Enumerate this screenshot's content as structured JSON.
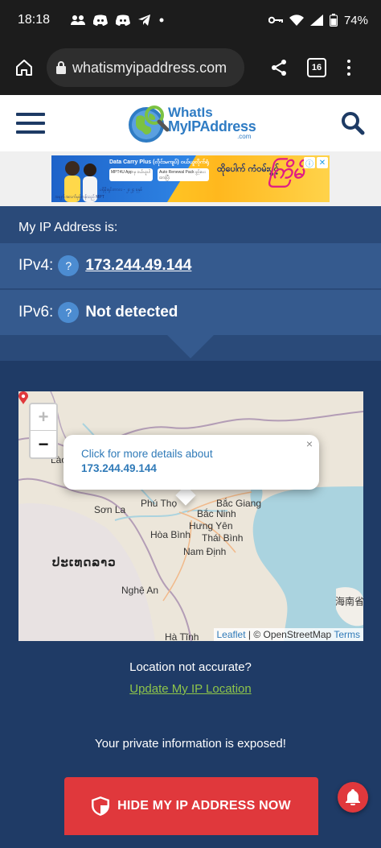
{
  "status_bar": {
    "time": "18:18",
    "battery": "74%",
    "icons_left": [
      "people-icon",
      "discord-icon",
      "discord-icon",
      "telegram-icon",
      "dot-icon"
    ],
    "icons_right": [
      "key-icon",
      "wifi-icon",
      "signal-icon",
      "battery-icon"
    ]
  },
  "browser": {
    "url": "whatismyipaddress.com",
    "tab_count": "16"
  },
  "site": {
    "logo_line1": "WhatIs",
    "logo_line2": "MyIPAddress",
    "logo_line3": ".com"
  },
  "ad": {
    "headline_small": "Data Carry Plus (လိုင်းမကျပ်) ဝယ်ယူလိုက်ရုံ",
    "box1": "MPT4U App မှ ဝယ်ယူပါ",
    "box2": "Auto Renewal Pack ဖွင့်ပေးထားပြီး",
    "headline_mm": "ထိုပေါက် ကံဝမ်းပွင့်",
    "brand_mm": "ကြိမ်",
    "footnote": "ပရိုမိုးရှင်းကာလ - ၂၀၂၄ ခုနှစ်",
    "bottom_note": "အချက်အလက်မှန်ကန်သည် MPT"
  },
  "ip": {
    "heading": "My IP Address is:",
    "ipv4_label": "IPv4:",
    "ipv4_value": "173.244.49.144",
    "ipv6_label": "IPv6:",
    "ipv6_value": "Not detected",
    "help_glyph": "?"
  },
  "map": {
    "zoom_in": "+",
    "zoom_out": "−",
    "popup_line1": "Click for more details about",
    "popup_line2": "173.244.49.144",
    "popup_close": "×",
    "places": {
      "lao": "Lào",
      "son_la": "Sơn La",
      "phu_tho": "Phú Thọ",
      "bac_giang": "Bắc Giang",
      "bac_ninh": "Bắc Ninh",
      "hung_yen": "Hưng Yên",
      "hoa_binh": "Hòa Bình",
      "thai_binh": "Thái Bình",
      "nam_dinh": "Nam Định",
      "laos": "ປະເທດລາວ",
      "nghe_an": "Nghệ An",
      "ha_tinh": "Hà Tĩnh",
      "hainan": "海南省"
    },
    "attribution_leaflet": "Leaflet",
    "attribution_sep": " | © OpenStreetMap ",
    "attribution_terms": "Terms"
  },
  "location": {
    "question": "Location not accurate?",
    "update_link": "Update My IP Location"
  },
  "exposed_text": "Your private information is exposed!",
  "hide_button": "HIDE MY IP ADDRESS NOW",
  "colors": {
    "header_navy": "#1d3a64",
    "ip_panel": "#2a4a79",
    "ip_row": "#355a8e",
    "main_bg": "#1f3b66",
    "link_green": "#8ec54a",
    "cta_red": "#e0383c"
  }
}
